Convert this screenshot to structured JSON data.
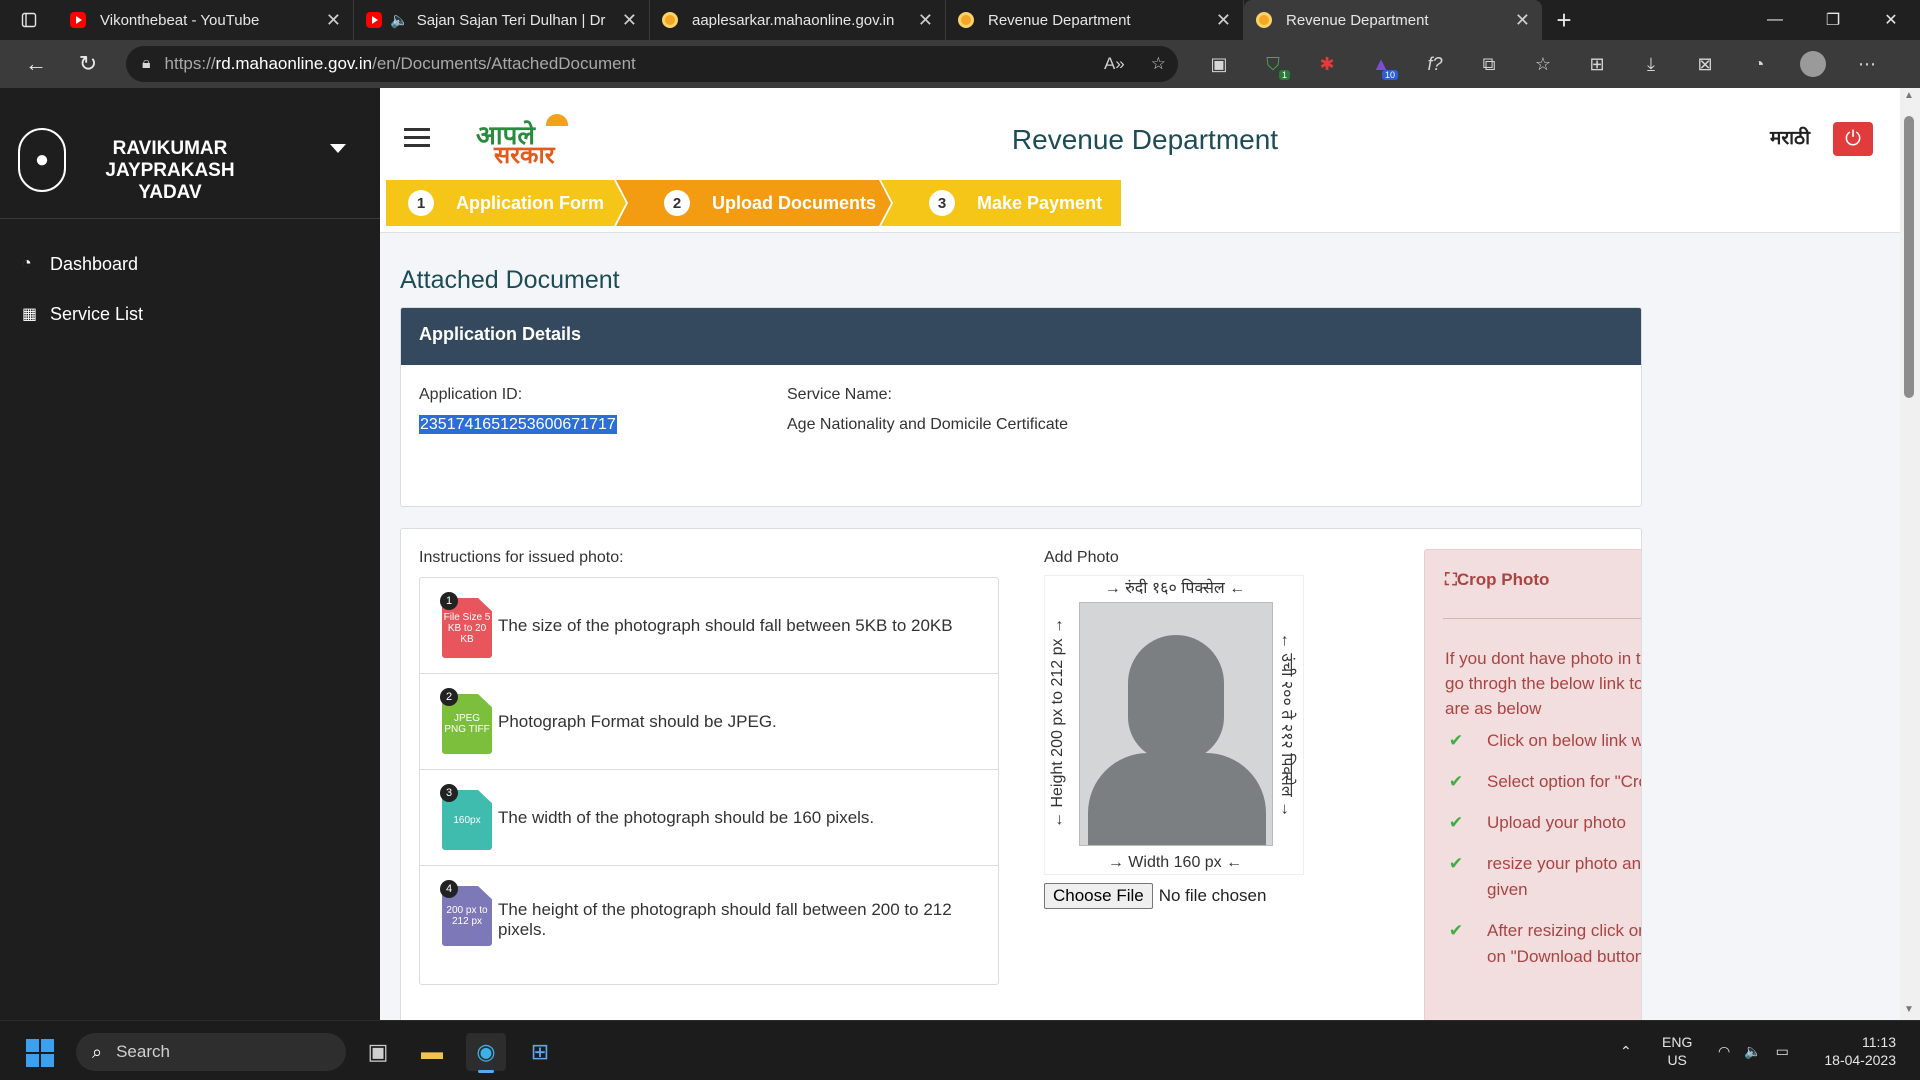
{
  "browser": {
    "tabs": [
      {
        "title": "Vikonthebeat - YouTube",
        "favicon": "youtube-icon",
        "active": false
      },
      {
        "title": "Sajan Sajan Teri Dulhan | Dr",
        "favicon": "youtube-icon",
        "active": false
      },
      {
        "title": "aaplesarkar.mahaonline.gov.in",
        "favicon": "gov-icon",
        "active": false
      },
      {
        "title": "Revenue Department",
        "favicon": "gov-icon",
        "active": false
      },
      {
        "title": "Revenue Department",
        "favicon": "gov-icon",
        "active": true
      }
    ],
    "url_prefix": "https://",
    "url_host": "rd.mahaonline.gov.in",
    "url_path": "/en/Documents/AttachedDocument",
    "extension_badges": {
      "shield": "1",
      "ext10": "10"
    }
  },
  "sidebar": {
    "user_name": "RAVIKUMAR JAYPRAKASH YADAV",
    "items": [
      {
        "label": "Dashboard",
        "icon": "dashboard-icon"
      },
      {
        "label": "Service List",
        "icon": "table-icon"
      }
    ]
  },
  "header": {
    "logo_line1": "आपले",
    "logo_line2": "सरकार",
    "title": "Revenue Department",
    "language": "मराठी"
  },
  "steps": [
    {
      "num": "1",
      "label": "Application Form"
    },
    {
      "num": "2",
      "label": "Upload Documents"
    },
    {
      "num": "3",
      "label": "Make Payment"
    }
  ],
  "page": {
    "heading": "Attached Document",
    "details_title": "Application Details",
    "application_id_label": "Application ID:",
    "application_id": "2351741651253600671717",
    "service_name_label": "Service Name:",
    "service_name": "Age Nationality and Domicile Certificate"
  },
  "instructions": {
    "title": "Instructions for issued photo:",
    "items": [
      {
        "num": "1",
        "icon_text": "File Size 5 KB to 20 KB",
        "text": "The size of the photograph should fall between 5KB to 20KB",
        "color": "#e9555c"
      },
      {
        "num": "2",
        "icon_text": "JPEG PNG TIFF",
        "text": "Photograph Format should be JPEG.",
        "color": "#7bbf3c"
      },
      {
        "num": "3",
        "icon_text": "160px",
        "text": "The width of the photograph should be 160 pixels.",
        "color": "#3fbcae"
      },
      {
        "num": "4",
        "icon_text": "200 px to 212 px",
        "text": "The height of the photograph should fall between 200 to 212 pixels.",
        "color": "#7d78b8"
      }
    ]
  },
  "photo": {
    "label": "Add Photo",
    "dim_top": "रुंदी १६० पिक्सेल",
    "dim_bottom": "Width 160 px",
    "dim_left": "Height 200 px to 212 px",
    "dim_right": "उंची २०० ते २१२ पिक्सेल",
    "choose_button": "Choose File",
    "file_status": "No file chosen"
  },
  "crop": {
    "title": "Crop Photo",
    "intro": "If you dont have photo in this mentioned size you can go throgh the below link to upload & crop photo. Steps are as below",
    "steps": [
      "Click on below link which will get you crop page",
      "Select option for \"Crop photo\"",
      "Upload your photo",
      "resize your photo and fit it inside the red mark given",
      "After resizing click on \"crop image\" and then click on \"Download button\" to get the photo"
    ]
  },
  "taskbar": {
    "search_placeholder": "Search",
    "lang_line1": "ENG",
    "lang_line2": "US",
    "time": "11:13",
    "date": "18-04-2023"
  },
  "colors": {
    "step_yellow": "#f5c518",
    "step_orange": "#f39c12",
    "details_header": "#34495e",
    "title_teal": "#1d4c56",
    "power_red": "#e03c3c"
  }
}
